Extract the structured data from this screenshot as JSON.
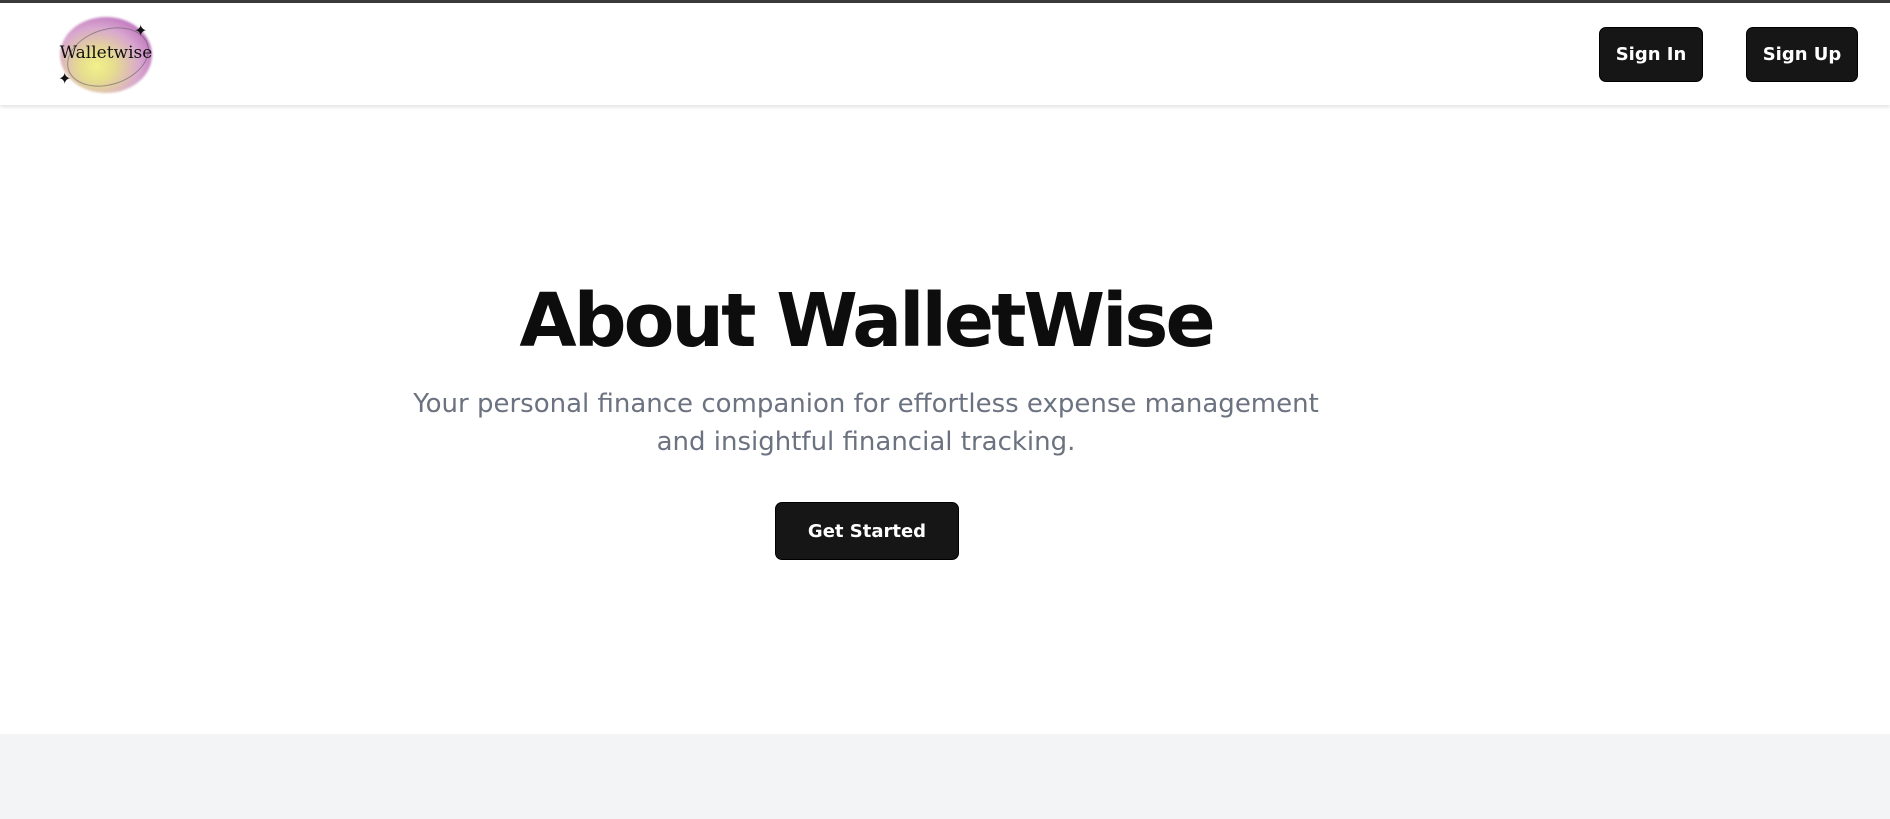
{
  "header": {
    "logo_text": "Walletwise",
    "sign_in_label": "Sign In",
    "sign_up_label": "Sign Up"
  },
  "hero": {
    "title": "About WalletWise",
    "subtitle": "Your personal finance companion for effortless expense management and insightful financial tracking.",
    "cta_label": "Get Started"
  },
  "colors": {
    "button_bg": "#161616",
    "subtitle_text": "#6b7280",
    "footer_band": "#f3f4f6"
  }
}
